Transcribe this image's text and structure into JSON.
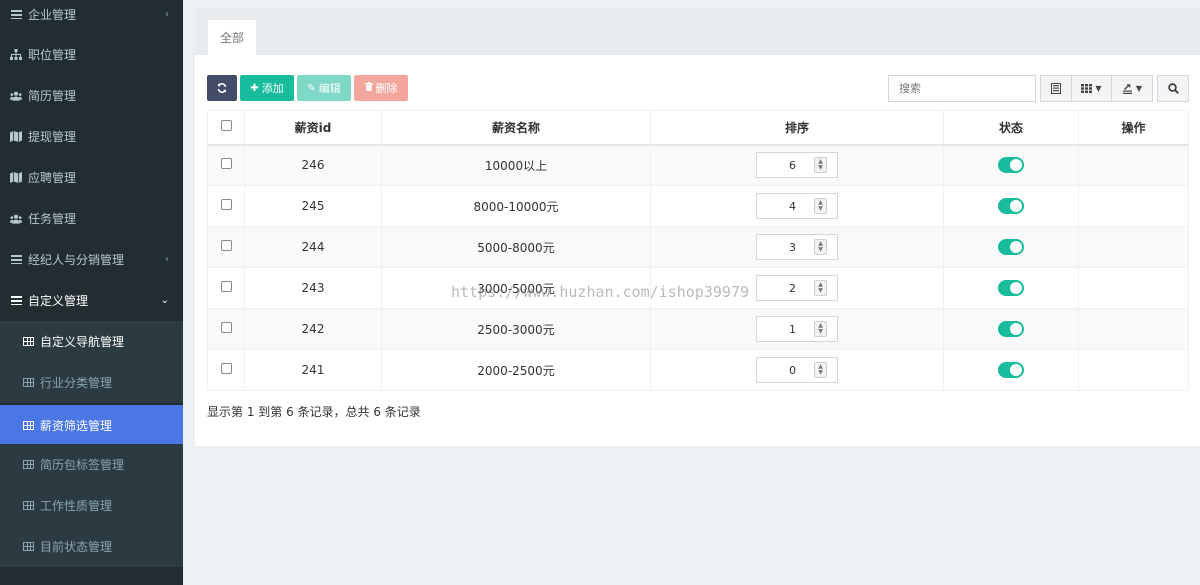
{
  "sidebar": {
    "items": [
      {
        "label": "企业管理",
        "icon": "bars-icon",
        "arrow": "‹"
      },
      {
        "label": "职位管理",
        "icon": "sitemap-icon"
      },
      {
        "label": "简历管理",
        "icon": "users-icon"
      },
      {
        "label": "提现管理",
        "icon": "map-icon"
      },
      {
        "label": "应聘管理",
        "icon": "map-icon"
      },
      {
        "label": "任务管理",
        "icon": "users-icon"
      },
      {
        "label": "经纪人与分销管理",
        "icon": "bars-icon",
        "arrow": "‹"
      },
      {
        "label": "自定义管理",
        "icon": "bars-icon",
        "arrow": "⌄"
      }
    ],
    "subitems": [
      {
        "label": "自定义导航管理",
        "icon": "table-icon"
      },
      {
        "label": "行业分类管理",
        "icon": "table-icon"
      },
      {
        "label": "薪资筛选管理",
        "icon": "table-icon"
      },
      {
        "label": "简历包标签管理",
        "icon": "table-icon"
      },
      {
        "label": "工作性质管理",
        "icon": "table-icon"
      },
      {
        "label": "目前状态管理",
        "icon": "table-icon"
      }
    ]
  },
  "tabs": [
    {
      "label": "全部"
    }
  ],
  "toolbar": {
    "add_label": "添加",
    "edit_label": "编辑",
    "delete_label": "删除",
    "search_placeholder": "搜索"
  },
  "table": {
    "headers": [
      "薪资id",
      "薪资名称",
      "排序",
      "状态",
      "操作"
    ],
    "rows": [
      {
        "id": "246",
        "name": "10000以上",
        "sort": "6",
        "status": true
      },
      {
        "id": "245",
        "name": "8000-10000元",
        "sort": "4",
        "status": true
      },
      {
        "id": "244",
        "name": "5000-8000元",
        "sort": "3",
        "status": true
      },
      {
        "id": "243",
        "name": "3000-5000元",
        "sort": "2",
        "status": true
      },
      {
        "id": "242",
        "name": "2500-3000元",
        "sort": "1",
        "status": true
      },
      {
        "id": "241",
        "name": "2000-2500元",
        "sort": "0",
        "status": true
      }
    ]
  },
  "pagination": {
    "info": "显示第 1 到第 6 条记录，总共 6 条记录"
  },
  "watermark": "https://www.huzhan.com/ishop39979",
  "colors": {
    "sidebar_bg": "#222d32",
    "active_item": "#4b77e5",
    "btn_refresh": "#444c69",
    "btn_add": "#18bc9c",
    "btn_edit": "#7fd7c7",
    "btn_delete": "#f3a69d",
    "toggle_on": "#18bc9c"
  }
}
